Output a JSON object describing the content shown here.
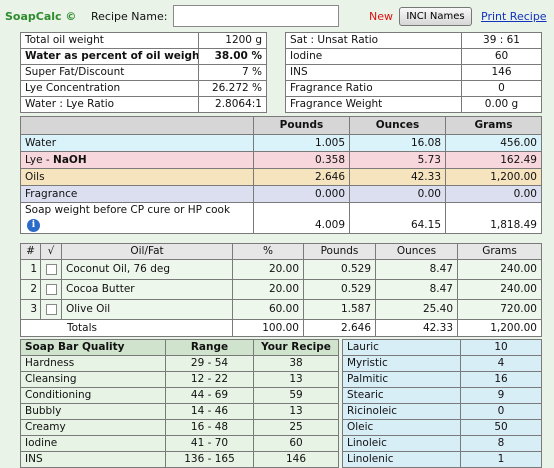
{
  "header": {
    "brand": "SoapCalc ©",
    "recipe_name_label": "Recipe Name:",
    "recipe_name_value": "",
    "new_label": "New",
    "inci_button": "INCI Names",
    "print_link": "Print Recipe"
  },
  "params": [
    {
      "label": "Total oil weight",
      "value": "1200 g",
      "bold": false
    },
    {
      "label": "Water as percent of oil weight",
      "value": "38.00 %",
      "bold": true
    },
    {
      "label": "Super Fat/Discount",
      "value": "7 %",
      "bold": false
    },
    {
      "label": "Lye Concentration",
      "value": "26.272 %",
      "bold": false
    },
    {
      "label": "Water : Lye Ratio",
      "value": "2.8064:1",
      "bold": false
    }
  ],
  "ratios": [
    {
      "label": "Sat : Unsat Ratio",
      "value": "39 : 61"
    },
    {
      "label": "Iodine",
      "value": "60"
    },
    {
      "label": "INS",
      "value": "146"
    },
    {
      "label": "Fragrance Ratio",
      "value": "0"
    },
    {
      "label": "Fragrance Weight",
      "value": "0.00 g"
    }
  ],
  "summary": {
    "headers": [
      "",
      "Pounds",
      "Ounces",
      "Grams"
    ],
    "rows": [
      {
        "label": "Water",
        "pounds": "1.005",
        "ounces": "16.08",
        "grams": "456.00"
      },
      {
        "label": "Lye - ",
        "label_bold": "NaOH",
        "pounds": "0.358",
        "ounces": "5.73",
        "grams": "162.49"
      },
      {
        "label": "Oils",
        "pounds": "2.646",
        "ounces": "42.33",
        "grams": "1,200.00"
      },
      {
        "label": "Fragrance",
        "pounds": "0.000",
        "ounces": "0.00",
        "grams": "0.00"
      },
      {
        "label": "Soap weight before CP cure or HP cook",
        "pounds": "4.009",
        "ounces": "64.15",
        "grams": "1,818.49"
      }
    ],
    "info_icon": "info-icon"
  },
  "oils": {
    "headers": [
      "#",
      "√",
      "Oil/Fat",
      "%",
      "Pounds",
      "Ounces",
      "Grams"
    ],
    "rows": [
      {
        "n": "1",
        "name": "Coconut Oil, 76 deg",
        "pct": "20.00",
        "pounds": "0.529",
        "ounces": "8.47",
        "grams": "240.00"
      },
      {
        "n": "2",
        "name": "Cocoa Butter",
        "pct": "20.00",
        "pounds": "0.529",
        "ounces": "8.47",
        "grams": "240.00"
      },
      {
        "n": "3",
        "name": "Olive Oil",
        "pct": "60.00",
        "pounds": "1.587",
        "ounces": "25.40",
        "grams": "720.00"
      }
    ],
    "totals": {
      "label": "Totals",
      "pct": "100.00",
      "pounds": "2.646",
      "ounces": "42.33",
      "grams": "1,200.00"
    }
  },
  "quality": {
    "headers": [
      "Soap Bar Quality",
      "Range",
      "Your Recipe"
    ],
    "rows": [
      {
        "name": "Hardness",
        "range": "29 - 54",
        "value": "38"
      },
      {
        "name": "Cleansing",
        "range": "12 - 22",
        "value": "13"
      },
      {
        "name": "Conditioning",
        "range": "44 - 69",
        "value": "59"
      },
      {
        "name": "Bubbly",
        "range": "14 - 46",
        "value": "13"
      },
      {
        "name": "Creamy",
        "range": "16 - 48",
        "value": "25"
      },
      {
        "name": "Iodine",
        "range": "41 - 70",
        "value": "60"
      },
      {
        "name": "INS",
        "range": "136 - 165",
        "value": "146"
      }
    ]
  },
  "fatty_acids": [
    {
      "name": "Lauric",
      "value": "10"
    },
    {
      "name": "Myristic",
      "value": "4"
    },
    {
      "name": "Palmitic",
      "value": "16"
    },
    {
      "name": "Stearic",
      "value": "9"
    },
    {
      "name": "Ricinoleic",
      "value": "0"
    },
    {
      "name": "Oleic",
      "value": "50"
    },
    {
      "name": "Linoleic",
      "value": "8"
    },
    {
      "name": "Linolenic",
      "value": "1"
    }
  ]
}
